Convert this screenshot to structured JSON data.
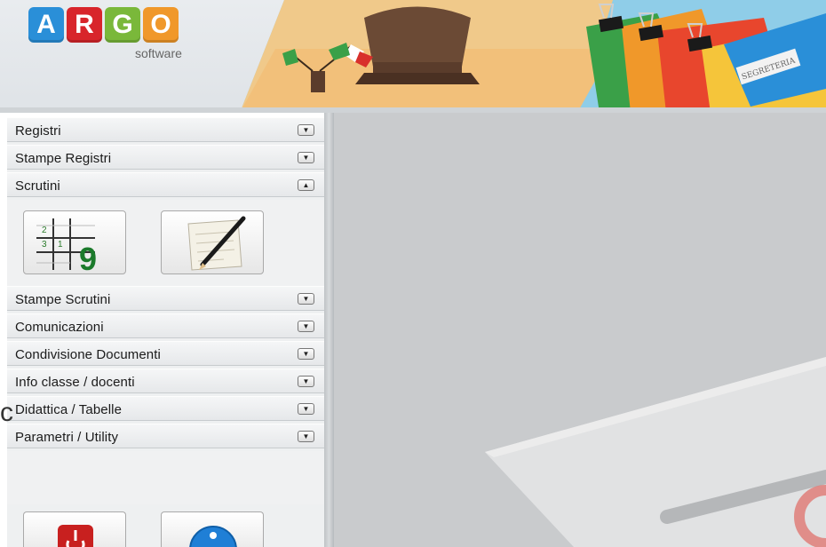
{
  "header": {
    "logo_letters": [
      "A",
      "R",
      "G",
      "O"
    ],
    "logo_subtitle": "software",
    "folder_label": "SEGRETERIA"
  },
  "sidebar": {
    "sections": [
      {
        "label": "Registri",
        "state": "collapsed"
      },
      {
        "label": "Stampe Registri",
        "state": "collapsed"
      },
      {
        "label": "Scrutini",
        "state": "expanded"
      },
      {
        "label": "Stampe Scrutini",
        "state": "collapsed"
      },
      {
        "label": "Comunicazioni",
        "state": "collapsed"
      },
      {
        "label": "Condivisione Documenti",
        "state": "collapsed"
      },
      {
        "label": "Info classe / docenti",
        "state": "collapsed"
      },
      {
        "label": "Didattica / Tabelle",
        "state": "collapsed"
      },
      {
        "label": "Parametri / Utility",
        "state": "collapsed"
      }
    ],
    "scrutini_tools": {
      "grid_digits": [
        "2",
        "3",
        "1"
      ],
      "grid_big_digit": "9"
    },
    "icon_names": {
      "collapsed_toggle": "chevron-down-icon",
      "expanded_toggle": "chevron-up-icon",
      "grades_grid": "grades-grid-icon",
      "notes_edit": "pencil-notepad-icon",
      "logout": "logout-icon",
      "info": "info-icon"
    }
  },
  "edge_fragment": "c",
  "colors": {
    "logo_blue": "#2a8fd8",
    "logo_red": "#d8252b",
    "logo_green": "#7ab83a",
    "logo_orange": "#f0982a",
    "content_bg": "#c9cbcd",
    "sidebar_bg": "#eef0f1"
  }
}
